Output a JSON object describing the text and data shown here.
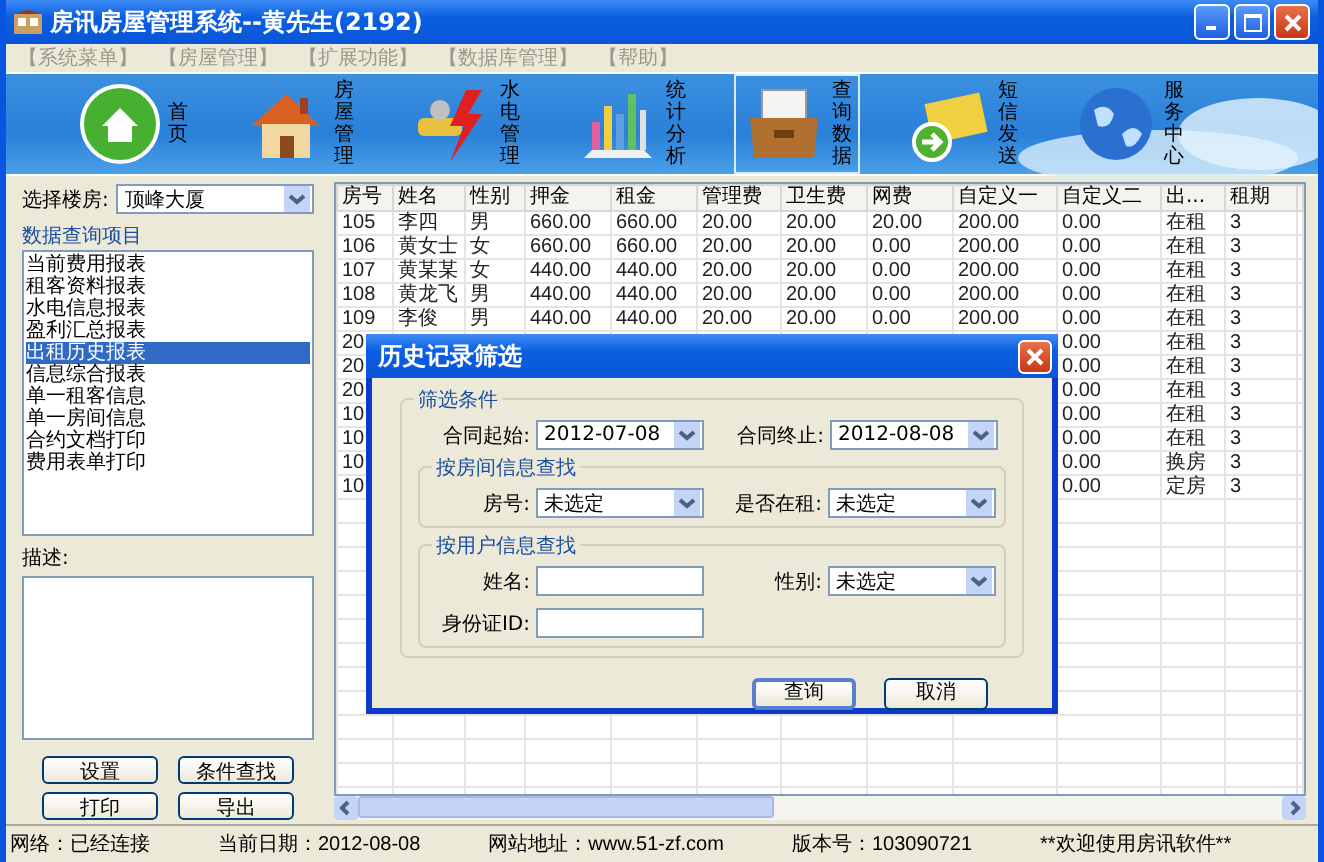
{
  "window": {
    "title": "房讯房屋管理系统--黄先生(2192)"
  },
  "menu": [
    {
      "label": "【系统菜单】",
      "disabled": true
    },
    {
      "label": "【房屋管理】",
      "disabled": true
    },
    {
      "label": "【扩展功能】",
      "disabled": true
    },
    {
      "label": "【数据库管理】",
      "disabled": true
    },
    {
      "label": "【帮助】",
      "disabled": true
    }
  ],
  "toolbar": [
    {
      "label": "首页",
      "selected": false
    },
    {
      "label": "房屋管理",
      "selected": false
    },
    {
      "label": "水电管理",
      "selected": false
    },
    {
      "label": "统计分析",
      "selected": false
    },
    {
      "label": "查询数据",
      "selected": true
    },
    {
      "label": "短信发送",
      "selected": false
    },
    {
      "label": "服务中心",
      "selected": false
    }
  ],
  "sidebar": {
    "building_label": "选择楼房:",
    "building": "顶峰大厦",
    "group_title": "数据查询项目",
    "items": [
      {
        "label": "当前费用报表",
        "selected": false
      },
      {
        "label": "租客资料报表",
        "selected": false
      },
      {
        "label": "水电信息报表",
        "selected": false
      },
      {
        "label": "盈利汇总报表",
        "selected": false
      },
      {
        "label": "出租历史报表",
        "selected": true
      },
      {
        "label": "信息综合报表",
        "selected": false
      },
      {
        "label": "单一租客信息",
        "selected": false
      },
      {
        "label": "单一房间信息",
        "selected": false
      },
      {
        "label": "合约文档打印",
        "selected": false
      },
      {
        "label": "费用表单打印",
        "selected": false
      }
    ],
    "description_label": "描述:",
    "buttons": [
      "设置",
      "条件查找",
      "打印",
      "导出"
    ]
  },
  "table": {
    "columns": [
      "房号",
      "姓名",
      "性别",
      "押金",
      "租金",
      "管理费",
      "卫生费",
      "网费",
      "自定义一",
      "自定义二",
      "出...",
      "租期"
    ],
    "rows": [
      {
        "room": "105",
        "name": "李四",
        "gender": "男",
        "deposit": "660.00",
        "rent": "660.00",
        "management": "20.00",
        "sanitation": "20.00",
        "network": "20.00",
        "custom_1": "200.00",
        "custom_2": "0.00",
        "status": "在租",
        "term": "3"
      },
      {
        "room": "106",
        "name": "黄女士",
        "gender": "女",
        "deposit": "660.00",
        "rent": "660.00",
        "management": "20.00",
        "sanitation": "20.00",
        "network": "0.00",
        "custom_1": "200.00",
        "custom_2": "0.00",
        "status": "在租",
        "term": "3"
      },
      {
        "room": "107",
        "name": "黄某某",
        "gender": "女",
        "deposit": "440.00",
        "rent": "440.00",
        "management": "20.00",
        "sanitation": "20.00",
        "network": "0.00",
        "custom_1": "200.00",
        "custom_2": "0.00",
        "status": "在租",
        "term": "3"
      },
      {
        "room": "108",
        "name": "黄龙飞",
        "gender": "男",
        "deposit": "440.00",
        "rent": "440.00",
        "management": "20.00",
        "sanitation": "20.00",
        "network": "0.00",
        "custom_1": "200.00",
        "custom_2": "0.00",
        "status": "在租",
        "term": "3"
      },
      {
        "room": "109",
        "name": "李俊",
        "gender": "男",
        "deposit": "440.00",
        "rent": "440.00",
        "management": "20.00",
        "sanitation": "20.00",
        "network": "0.00",
        "custom_1": "200.00",
        "custom_2": "0.00",
        "status": "在租",
        "term": "3"
      },
      {
        "room": "20",
        "custom_2": "0.00",
        "status": "在租",
        "term": "3"
      },
      {
        "room": "20",
        "custom_2": "0.00",
        "status": "在租",
        "term": "3"
      },
      {
        "room": "20",
        "custom_2": "0.00",
        "status": "在租",
        "term": "3"
      },
      {
        "room": "10",
        "custom_2": "0.00",
        "status": "在租",
        "term": "3"
      },
      {
        "room": "10",
        "custom_2": "0.00",
        "status": "在租",
        "term": "3"
      },
      {
        "room": "10",
        "custom_2": "0.00",
        "status": "换房",
        "term": "3"
      },
      {
        "room": "10",
        "custom_2": "0.00",
        "status": "定房",
        "term": "3"
      }
    ]
  },
  "dialog": {
    "title": "历史记录筛选",
    "legend": "筛选条件",
    "dates": [
      {
        "label": "合同起始:",
        "kind": "select",
        "value": "2012-07-08"
      },
      {
        "label": "合同终止:",
        "kind": "select",
        "value": "2012-08-08"
      }
    ],
    "groups": [
      {
        "legend": "按房间信息查找",
        "fields": [
          {
            "label": "房号:",
            "kind": "select",
            "value": "未选定"
          },
          {
            "label": "是否在租:",
            "kind": "select",
            "value": "未选定"
          }
        ]
      },
      {
        "legend": "按用户信息查找",
        "fields": [
          {
            "label": "姓名:",
            "kind": "text"
          },
          {
            "label": "性别:",
            "kind": "select",
            "value": "未选定"
          },
          {
            "label": "身份证ID:",
            "kind": "text"
          }
        ]
      }
    ],
    "buttons": [
      {
        "label": "查询",
        "default": true
      },
      {
        "label": "取消",
        "default": false
      }
    ]
  },
  "status_bar": [
    "网络：已经连接",
    "当前日期：2012-08-08",
    "网站地址：www.51-zf.com",
    "版本号：103090721",
    "**欢迎使用房讯软件**"
  ]
}
